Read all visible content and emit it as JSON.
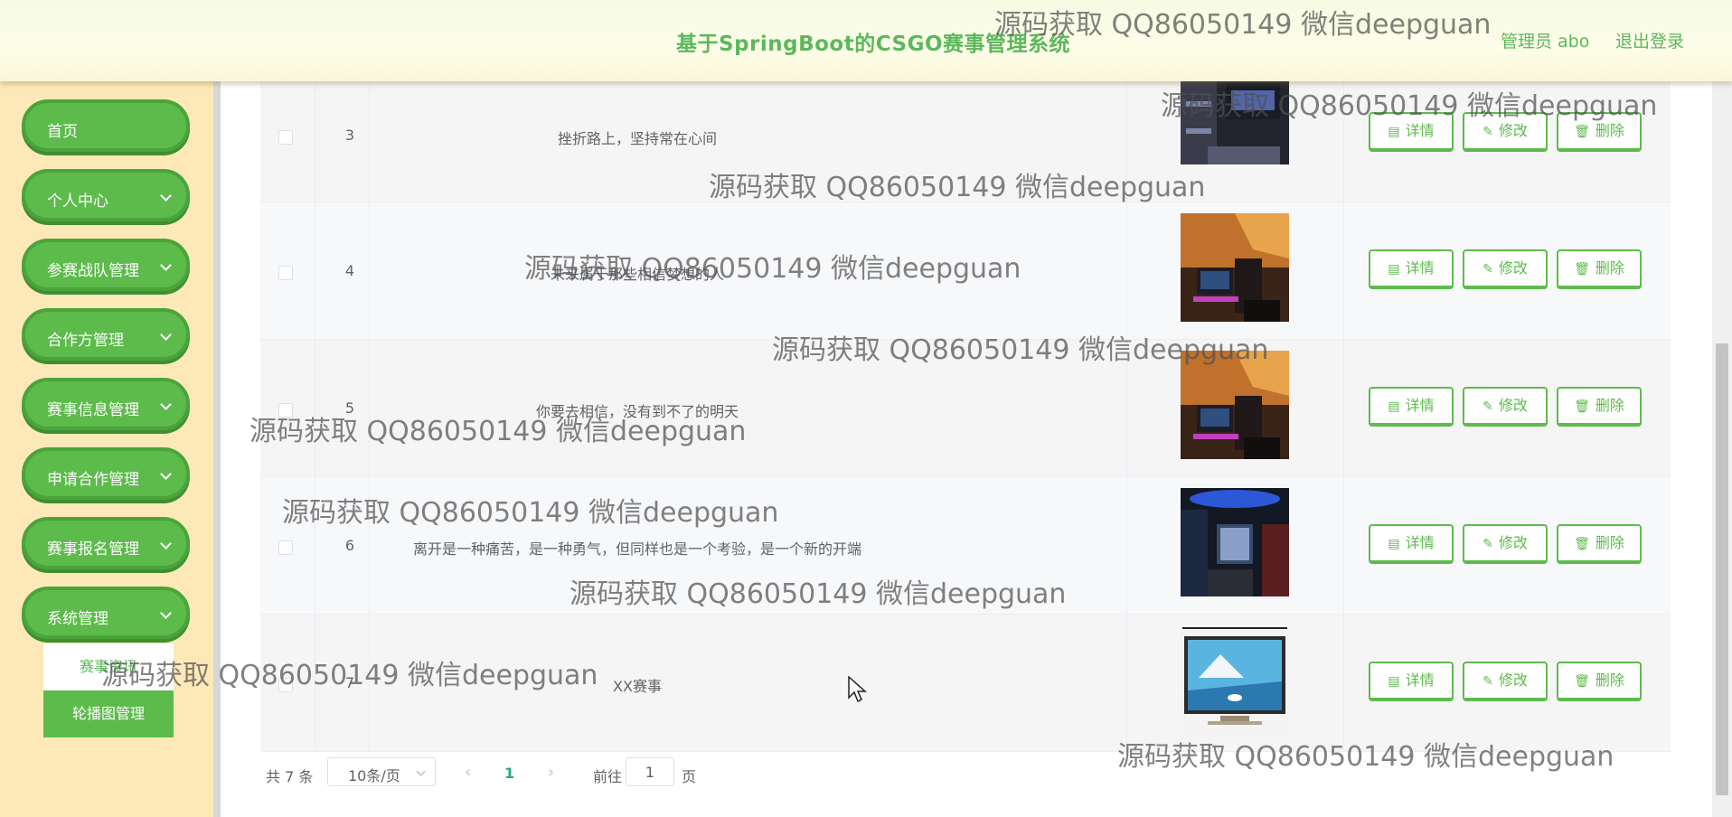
{
  "header": {
    "title": "基于SpringBoot的CSGO赛事管理系统",
    "user": "管理员 abo",
    "logout": "退出登录"
  },
  "sidebar": {
    "items": [
      {
        "label": "首页"
      },
      {
        "label": "个人中心"
      },
      {
        "label": "参赛战队管理"
      },
      {
        "label": "合作方管理"
      },
      {
        "label": "赛事信息管理"
      },
      {
        "label": "申请合作管理"
      },
      {
        "label": "赛事报名管理"
      },
      {
        "label": "系统管理"
      }
    ],
    "submenu": [
      "赛事资讯",
      "轮播图管理"
    ]
  },
  "table": {
    "rows": [
      {
        "index": "3",
        "title": "挫折路上，坚持常在心间",
        "thumb": "dark-room-icon"
      },
      {
        "index": "4",
        "title": "未来属于那些相信梦想的人",
        "thumb": "gaming-room-icon"
      },
      {
        "index": "5",
        "title": "你要去相信，没有到不了的明天",
        "thumb": "gaming-room-icon"
      },
      {
        "index": "6",
        "title": "离开是一种痛苦，是一种勇气，但同样也是一个考验，是一个新的开端",
        "thumb": "blue-room-icon"
      },
      {
        "index": "7",
        "title": "XX赛事",
        "thumb": "tv-mountain-icon"
      }
    ],
    "actions": {
      "detail": "详情",
      "edit": "修改",
      "delete": "删除"
    }
  },
  "pagination": {
    "total": "共 7 条",
    "page_size": "10条/页",
    "current_page": "1",
    "goto_label": "前往",
    "goto_value": "1",
    "page_unit": "页"
  },
  "watermark": "源码获取 QQ86050149 微信deepguan",
  "colors": {
    "accent": "#5dbb4c",
    "sidebar_bg": "#fde9b8"
  }
}
